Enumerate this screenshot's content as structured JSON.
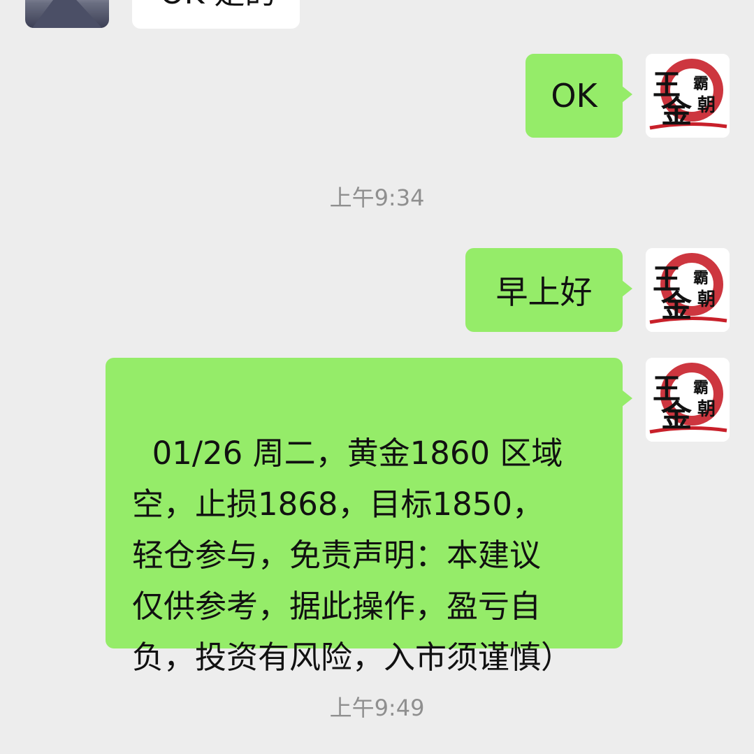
{
  "chat": {
    "partial_message_text": "OK 是的",
    "messages": [
      {
        "text": "OK"
      },
      {
        "text": "早上好"
      },
      {
        "text": "01/26 周二，黄金1860 区域\n空，止损1868，目标1850，\n轻仓参与，免责声明：本建议\n仅供参考，据此操作，盈亏自\n负，投资有风险，入市须谨慎）"
      }
    ],
    "timestamps": [
      "上午9:34",
      "上午9:49"
    ]
  },
  "avatar": {
    "logo_main_chars": "王金",
    "logo_side_chars": "霸朝",
    "logo_accent_color": "#c8202a"
  },
  "colors": {
    "background": "#ededed",
    "outgoing_bubble": "#95ec69",
    "incoming_bubble": "#ffffff",
    "timestamp_text": "#8f8f8f"
  }
}
